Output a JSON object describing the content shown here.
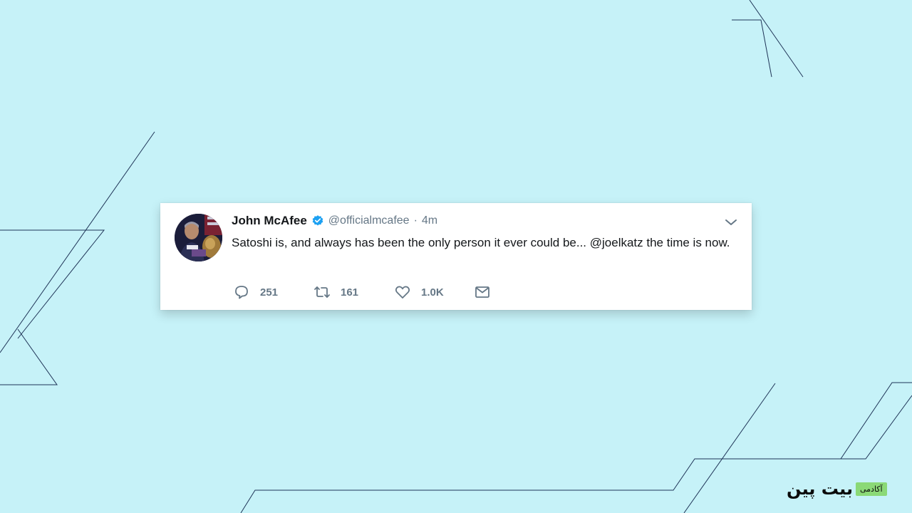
{
  "tweet": {
    "author_name": "John McAfee",
    "handle": "@officialmcafee",
    "separator": "·",
    "timestamp": "4m",
    "text": "Satoshi is, and always has been the only person it ever could be... @joelkatz the time is now.",
    "actions": {
      "replies": "251",
      "retweets": "161",
      "likes": "1.0K"
    },
    "icons": {
      "verified": "verified-badge-icon",
      "caret": "chevron-down-icon",
      "reply": "speech-bubble-icon",
      "retweet": "retweet-arrows-icon",
      "like": "heart-icon",
      "message": "envelope-icon"
    }
  },
  "branding": {
    "name": "بیت پین",
    "tag": "آکادمی"
  },
  "colors": {
    "background": "#c6f2f8",
    "line_color": "#1f3457",
    "verified_blue": "#1da1f2",
    "muted_text": "#657786",
    "brand_tag_green": "#8bd977"
  }
}
